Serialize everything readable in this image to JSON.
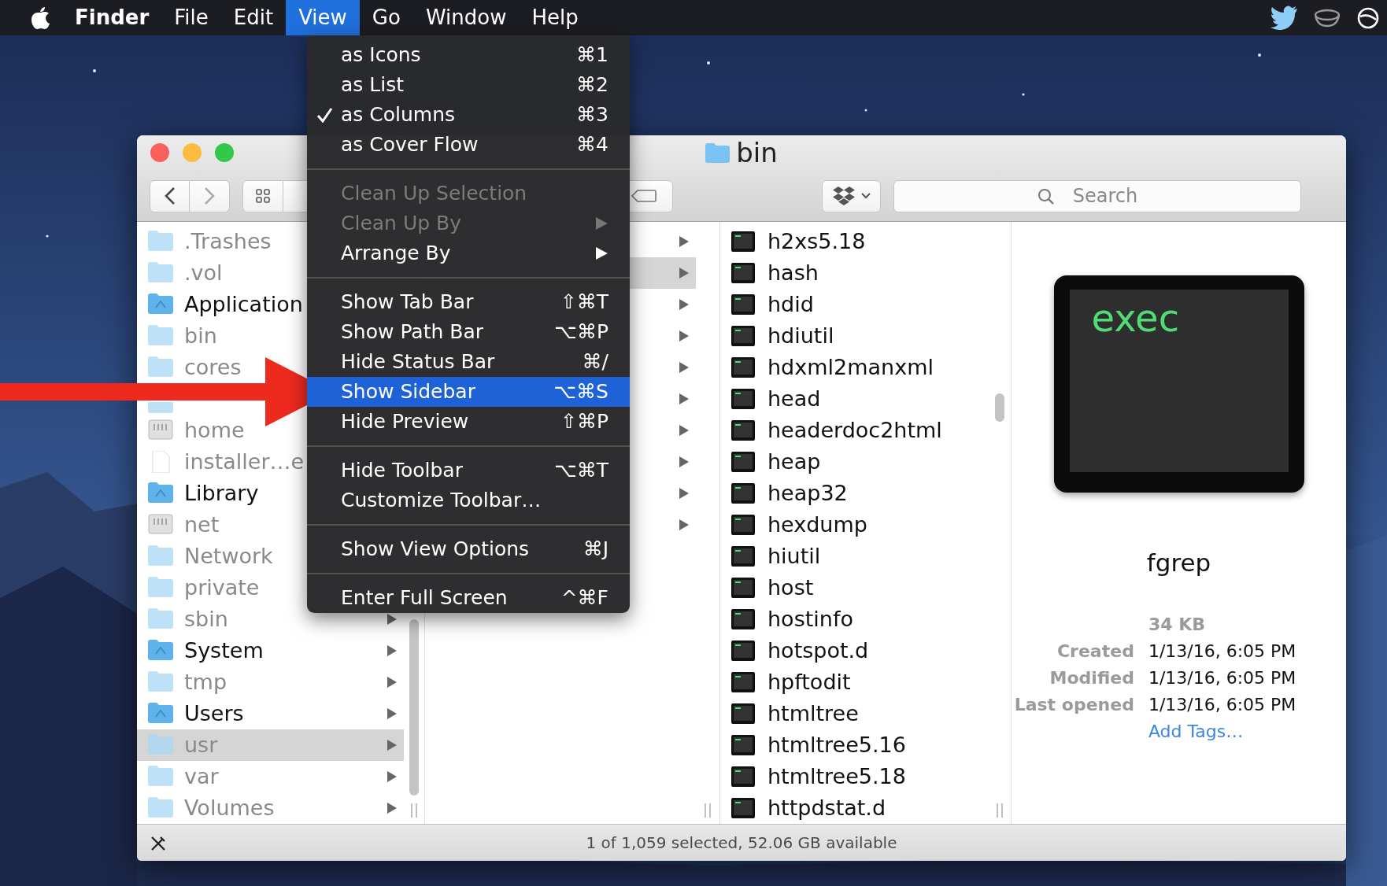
{
  "menu_bar": {
    "items": [
      {
        "label": "Finder",
        "bold": true,
        "selected": false
      },
      {
        "label": "File",
        "bold": false,
        "selected": false
      },
      {
        "label": "Edit",
        "bold": false,
        "selected": false
      },
      {
        "label": "View",
        "bold": false,
        "selected": true
      },
      {
        "label": "Go",
        "bold": false,
        "selected": false
      },
      {
        "label": "Window",
        "bold": false,
        "selected": false
      },
      {
        "label": "Help",
        "bold": false,
        "selected": false
      }
    ]
  },
  "view_menu": {
    "sections": [
      {
        "items": [
          {
            "label": "as Icons",
            "shortcut": "⌘1",
            "checked": false,
            "disabled": false,
            "selected": false,
            "submenu": false
          },
          {
            "label": "as List",
            "shortcut": "⌘2",
            "checked": false,
            "disabled": false,
            "selected": false,
            "submenu": false
          },
          {
            "label": "as Columns",
            "shortcut": "⌘3",
            "checked": true,
            "disabled": false,
            "selected": false,
            "submenu": false
          },
          {
            "label": "as Cover Flow",
            "shortcut": "⌘4",
            "checked": false,
            "disabled": false,
            "selected": false,
            "submenu": false
          }
        ]
      },
      {
        "items": [
          {
            "label": "Clean Up Selection",
            "checked": false,
            "disabled": true,
            "selected": false,
            "submenu": false
          },
          {
            "label": "Clean Up By",
            "checked": false,
            "disabled": true,
            "selected": false,
            "submenu": true
          },
          {
            "label": "Arrange By",
            "checked": false,
            "disabled": false,
            "selected": false,
            "submenu": true
          }
        ]
      },
      {
        "items": [
          {
            "label": "Show Tab Bar",
            "shortcut": "⇧⌘T",
            "checked": false,
            "disabled": false,
            "selected": false,
            "submenu": false
          },
          {
            "label": "Show Path Bar",
            "shortcut": "⌥⌘P",
            "checked": false,
            "disabled": false,
            "selected": false,
            "submenu": false
          },
          {
            "label": "Hide Status Bar",
            "shortcut": "⌘/",
            "checked": false,
            "disabled": false,
            "selected": false,
            "submenu": false
          },
          {
            "label": "Show Sidebar",
            "shortcut": "⌥⌘S",
            "checked": false,
            "disabled": false,
            "selected": true,
            "submenu": false
          },
          {
            "label": "Hide Preview",
            "shortcut": "⇧⌘P",
            "checked": false,
            "disabled": false,
            "selected": false,
            "submenu": false
          }
        ]
      },
      {
        "items": [
          {
            "label": "Hide Toolbar",
            "shortcut": "⌥⌘T",
            "checked": false,
            "disabled": false,
            "selected": false,
            "submenu": false
          },
          {
            "label": "Customize Toolbar…",
            "checked": false,
            "disabled": false,
            "selected": false,
            "submenu": false
          }
        ]
      },
      {
        "items": [
          {
            "label": "Show View Options",
            "shortcut": "⌘J",
            "checked": false,
            "disabled": false,
            "selected": false,
            "submenu": false
          }
        ]
      },
      {
        "items": [
          {
            "label": "Enter Full Screen",
            "shortcut": "^⌘F",
            "checked": false,
            "disabled": false,
            "selected": false,
            "submenu": false
          }
        ]
      }
    ]
  },
  "window": {
    "title": "bin",
    "search": {
      "placeholder": "Search"
    }
  },
  "sidebar_column": {
    "rows": [
      {
        "name": ".Trashes",
        "kind": "folder",
        "dimmed": true,
        "arrow": false,
        "selected": false
      },
      {
        "name": ".vol",
        "kind": "folder",
        "dimmed": true,
        "arrow": false,
        "selected": false
      },
      {
        "name": "Application",
        "kind": "special_folder",
        "dimmed": false,
        "arrow": false,
        "selected": false
      },
      {
        "name": "bin",
        "kind": "folder",
        "dimmed": true,
        "arrow": false,
        "selected": false
      },
      {
        "name": "cores",
        "kind": "folder",
        "dimmed": true,
        "arrow": false,
        "selected": false
      },
      {
        "kind": "folder",
        "dimmed": true,
        "arrow": false,
        "selected": false
      },
      {
        "name": "home",
        "kind": "drive",
        "dimmed": true,
        "arrow": false,
        "selected": false
      },
      {
        "name": "installer…e",
        "kind": "document",
        "dimmed": true,
        "arrow": false,
        "selected": false
      },
      {
        "name": "Library",
        "kind": "special_folder",
        "dimmed": false,
        "arrow": false,
        "selected": false
      },
      {
        "name": "net",
        "kind": "drive",
        "dimmed": true,
        "arrow": false,
        "selected": false
      },
      {
        "name": "Network",
        "kind": "folder",
        "dimmed": true,
        "arrow": false,
        "selected": false
      },
      {
        "name": "private",
        "kind": "folder",
        "dimmed": true,
        "arrow": false,
        "selected": false
      },
      {
        "name": "sbin",
        "kind": "folder",
        "dimmed": true,
        "arrow": true,
        "selected": false
      },
      {
        "name": "System",
        "kind": "special_folder",
        "dimmed": false,
        "arrow": true,
        "selected": false
      },
      {
        "name": "tmp",
        "kind": "folder",
        "dimmed": true,
        "arrow": true,
        "selected": false
      },
      {
        "name": "Users",
        "kind": "special_folder",
        "dimmed": false,
        "arrow": true,
        "selected": false
      },
      {
        "name": "usr",
        "kind": "folder",
        "dimmed": true,
        "arrow": true,
        "selected": true
      },
      {
        "name": "var",
        "kind": "folder",
        "dimmed": true,
        "arrow": true,
        "selected": false
      },
      {
        "name": "Volumes",
        "kind": "folder",
        "dimmed": true,
        "arrow": true,
        "selected": false
      }
    ]
  },
  "column_2": {
    "rows": [
      {
        "selected": false
      },
      {
        "selected": true
      },
      {
        "selected": false
      },
      {
        "selected": false
      },
      {
        "selected": false
      },
      {
        "selected": false
      },
      {
        "selected": false
      },
      {
        "selected": false
      },
      {
        "selected": false
      },
      {
        "selected": false
      }
    ]
  },
  "files_column": {
    "rows": [
      {
        "name": "h2xs5.18"
      },
      {
        "name": "hash"
      },
      {
        "name": "hdid"
      },
      {
        "name": "hdiutil"
      },
      {
        "name": "hdxml2manxml"
      },
      {
        "name": "head"
      },
      {
        "name": "headerdoc2html"
      },
      {
        "name": "heap"
      },
      {
        "name": "heap32"
      },
      {
        "name": "hexdump"
      },
      {
        "name": "hiutil"
      },
      {
        "name": "host"
      },
      {
        "name": "hostinfo"
      },
      {
        "name": "hotspot.d"
      },
      {
        "name": "hpftodit"
      },
      {
        "name": "htmltree"
      },
      {
        "name": "htmltree5.16"
      },
      {
        "name": "htmltree5.18"
      },
      {
        "name": "httpdstat.d"
      }
    ]
  },
  "preview": {
    "icon_text": "exec",
    "name": "fgrep",
    "size": "34 KB",
    "details": [
      {
        "label": "Created",
        "value": "1/13/16, 6:05 PM"
      },
      {
        "label": "Modified",
        "value": "1/13/16, 6:05 PM"
      },
      {
        "label": "Last opened",
        "value": "1/13/16, 6:05 PM"
      }
    ],
    "add_tags": "Add Tags…"
  },
  "status_bar": {
    "text": "1 of 1,059 selected, 52.06 GB available"
  }
}
